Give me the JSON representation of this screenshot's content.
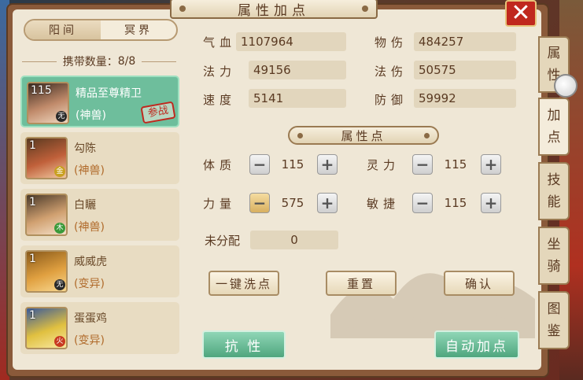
{
  "title": "属性加点",
  "close_label": "✕",
  "segment": {
    "tabs": [
      "阳间",
      "冥界"
    ],
    "active": 0
  },
  "carry": {
    "label": "携带数量：",
    "value": "8/8"
  },
  "pets": [
    {
      "level": "115",
      "name": "精品至尊精卫",
      "type": "(神兽)",
      "element": "无",
      "stamp": "参战",
      "selected": true
    },
    {
      "level": "1",
      "name": "勾陈",
      "type": "(神兽)",
      "element": "金",
      "stamp": "",
      "selected": false
    },
    {
      "level": "1",
      "name": "白矖",
      "type": "(神兽)",
      "element": "木",
      "stamp": "",
      "selected": false
    },
    {
      "level": "1",
      "name": "威威虎",
      "type": "(变异)",
      "element": "无",
      "stamp": "",
      "selected": false
    },
    {
      "level": "1",
      "name": "蛋蛋鸡",
      "type": "(变异)",
      "element": "火",
      "stamp": "",
      "selected": false
    }
  ],
  "stats": {
    "qixue": {
      "label": "气血",
      "value": "1107964"
    },
    "wushang": {
      "label": "物伤",
      "value": "484257"
    },
    "fali": {
      "label": "法力",
      "value": "49156"
    },
    "fashang": {
      "label": "法伤",
      "value": "50575"
    },
    "sudu": {
      "label": "速度",
      "value": "5141"
    },
    "fangyu": {
      "label": "防御",
      "value": "59992"
    }
  },
  "attr_section_title": "属性点",
  "attrs": {
    "tizhi": {
      "label": "体质",
      "value": "115"
    },
    "lingli": {
      "label": "灵力",
      "value": "115"
    },
    "liliang": {
      "label": "力量",
      "value": "575"
    },
    "minjie": {
      "label": "敏捷",
      "value": "115"
    }
  },
  "unassigned": {
    "label": "未分配",
    "value": "0"
  },
  "buttons": {
    "reset_all": "一键洗点",
    "reset": "重置",
    "confirm": "确认",
    "resist": "抗 性",
    "auto_add": "自动加点"
  },
  "side_tabs": [
    "属性",
    "加点",
    "技能",
    "坐骑",
    "图鉴"
  ],
  "active_side_tab": 1
}
